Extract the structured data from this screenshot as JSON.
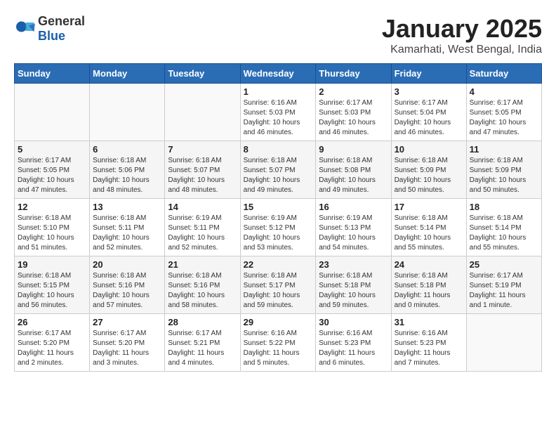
{
  "header": {
    "logo_general": "General",
    "logo_blue": "Blue",
    "month_title": "January 2025",
    "location": "Kamarhati, West Bengal, India"
  },
  "days_of_week": [
    "Sunday",
    "Monday",
    "Tuesday",
    "Wednesday",
    "Thursday",
    "Friday",
    "Saturday"
  ],
  "weeks": [
    [
      {
        "day": "",
        "info": ""
      },
      {
        "day": "",
        "info": ""
      },
      {
        "day": "",
        "info": ""
      },
      {
        "day": "1",
        "info": "Sunrise: 6:16 AM\nSunset: 5:03 PM\nDaylight: 10 hours\nand 46 minutes."
      },
      {
        "day": "2",
        "info": "Sunrise: 6:17 AM\nSunset: 5:03 PM\nDaylight: 10 hours\nand 46 minutes."
      },
      {
        "day": "3",
        "info": "Sunrise: 6:17 AM\nSunset: 5:04 PM\nDaylight: 10 hours\nand 46 minutes."
      },
      {
        "day": "4",
        "info": "Sunrise: 6:17 AM\nSunset: 5:05 PM\nDaylight: 10 hours\nand 47 minutes."
      }
    ],
    [
      {
        "day": "5",
        "info": "Sunrise: 6:17 AM\nSunset: 5:05 PM\nDaylight: 10 hours\nand 47 minutes."
      },
      {
        "day": "6",
        "info": "Sunrise: 6:18 AM\nSunset: 5:06 PM\nDaylight: 10 hours\nand 48 minutes."
      },
      {
        "day": "7",
        "info": "Sunrise: 6:18 AM\nSunset: 5:07 PM\nDaylight: 10 hours\nand 48 minutes."
      },
      {
        "day": "8",
        "info": "Sunrise: 6:18 AM\nSunset: 5:07 PM\nDaylight: 10 hours\nand 49 minutes."
      },
      {
        "day": "9",
        "info": "Sunrise: 6:18 AM\nSunset: 5:08 PM\nDaylight: 10 hours\nand 49 minutes."
      },
      {
        "day": "10",
        "info": "Sunrise: 6:18 AM\nSunset: 5:09 PM\nDaylight: 10 hours\nand 50 minutes."
      },
      {
        "day": "11",
        "info": "Sunrise: 6:18 AM\nSunset: 5:09 PM\nDaylight: 10 hours\nand 50 minutes."
      }
    ],
    [
      {
        "day": "12",
        "info": "Sunrise: 6:18 AM\nSunset: 5:10 PM\nDaylight: 10 hours\nand 51 minutes."
      },
      {
        "day": "13",
        "info": "Sunrise: 6:18 AM\nSunset: 5:11 PM\nDaylight: 10 hours\nand 52 minutes."
      },
      {
        "day": "14",
        "info": "Sunrise: 6:19 AM\nSunset: 5:11 PM\nDaylight: 10 hours\nand 52 minutes."
      },
      {
        "day": "15",
        "info": "Sunrise: 6:19 AM\nSunset: 5:12 PM\nDaylight: 10 hours\nand 53 minutes."
      },
      {
        "day": "16",
        "info": "Sunrise: 6:19 AM\nSunset: 5:13 PM\nDaylight: 10 hours\nand 54 minutes."
      },
      {
        "day": "17",
        "info": "Sunrise: 6:18 AM\nSunset: 5:14 PM\nDaylight: 10 hours\nand 55 minutes."
      },
      {
        "day": "18",
        "info": "Sunrise: 6:18 AM\nSunset: 5:14 PM\nDaylight: 10 hours\nand 55 minutes."
      }
    ],
    [
      {
        "day": "19",
        "info": "Sunrise: 6:18 AM\nSunset: 5:15 PM\nDaylight: 10 hours\nand 56 minutes."
      },
      {
        "day": "20",
        "info": "Sunrise: 6:18 AM\nSunset: 5:16 PM\nDaylight: 10 hours\nand 57 minutes."
      },
      {
        "day": "21",
        "info": "Sunrise: 6:18 AM\nSunset: 5:16 PM\nDaylight: 10 hours\nand 58 minutes."
      },
      {
        "day": "22",
        "info": "Sunrise: 6:18 AM\nSunset: 5:17 PM\nDaylight: 10 hours\nand 59 minutes."
      },
      {
        "day": "23",
        "info": "Sunrise: 6:18 AM\nSunset: 5:18 PM\nDaylight: 10 hours\nand 59 minutes."
      },
      {
        "day": "24",
        "info": "Sunrise: 6:18 AM\nSunset: 5:18 PM\nDaylight: 11 hours\nand 0 minutes."
      },
      {
        "day": "25",
        "info": "Sunrise: 6:17 AM\nSunset: 5:19 PM\nDaylight: 11 hours\nand 1 minute."
      }
    ],
    [
      {
        "day": "26",
        "info": "Sunrise: 6:17 AM\nSunset: 5:20 PM\nDaylight: 11 hours\nand 2 minutes."
      },
      {
        "day": "27",
        "info": "Sunrise: 6:17 AM\nSunset: 5:20 PM\nDaylight: 11 hours\nand 3 minutes."
      },
      {
        "day": "28",
        "info": "Sunrise: 6:17 AM\nSunset: 5:21 PM\nDaylight: 11 hours\nand 4 minutes."
      },
      {
        "day": "29",
        "info": "Sunrise: 6:16 AM\nSunset: 5:22 PM\nDaylight: 11 hours\nand 5 minutes."
      },
      {
        "day": "30",
        "info": "Sunrise: 6:16 AM\nSunset: 5:23 PM\nDaylight: 11 hours\nand 6 minutes."
      },
      {
        "day": "31",
        "info": "Sunrise: 6:16 AM\nSunset: 5:23 PM\nDaylight: 11 hours\nand 7 minutes."
      },
      {
        "day": "",
        "info": ""
      }
    ]
  ]
}
